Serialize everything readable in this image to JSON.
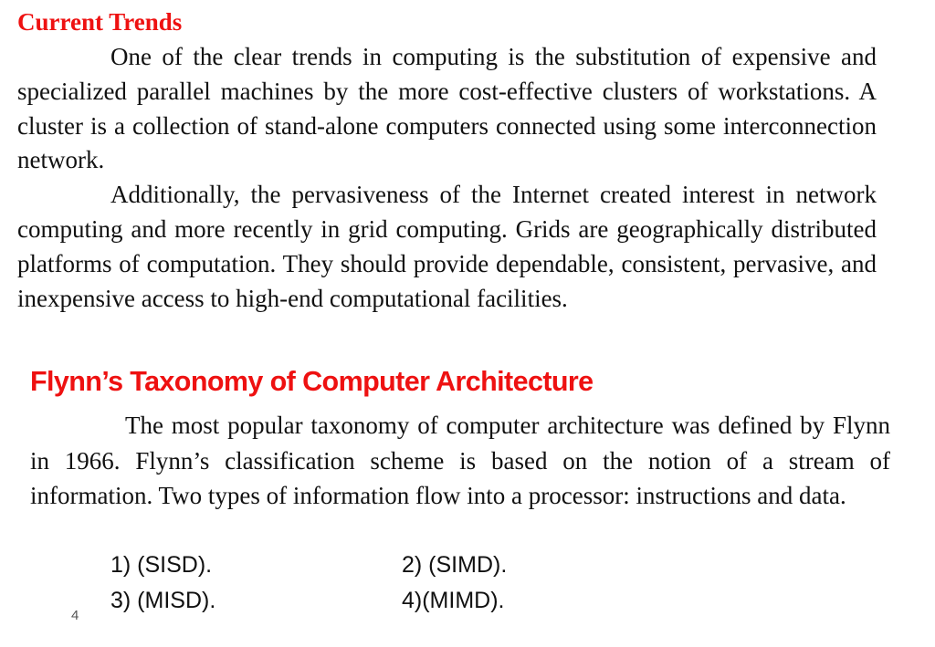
{
  "section1": {
    "title": "Current Trends",
    "paragraphs": [
      "One of the clear trends in computing is the substitution of expensive and specialized parallel machines by the more cost-effective clusters of workstations. A cluster is a collection of stand-alone computers connected using some interconnection network.",
      "Additionally, the pervasiveness of the Internet created interest in network computing and more recently in grid computing. Grids are geographically distributed platforms of computation. They should provide dependable, consistent, pervasive, and inexpensive access to high-end computational facilities."
    ]
  },
  "section2": {
    "title": "Flynn’s Taxonomy of Computer Architecture",
    "paragraph": "The most popular taxonomy of computer architecture was defined by Flynn in 1966. Flynn’s classification scheme is based on the notion of a stream of information. Two types of information flow into a processor: instructions and data.",
    "classes": [
      "1) (SISD).",
      "2) (SIMD).",
      "3) (MISD).",
      "4)(MIMD)."
    ]
  },
  "slide_number": "4",
  "colors": {
    "heading": "#ee1111",
    "text": "#111111"
  }
}
